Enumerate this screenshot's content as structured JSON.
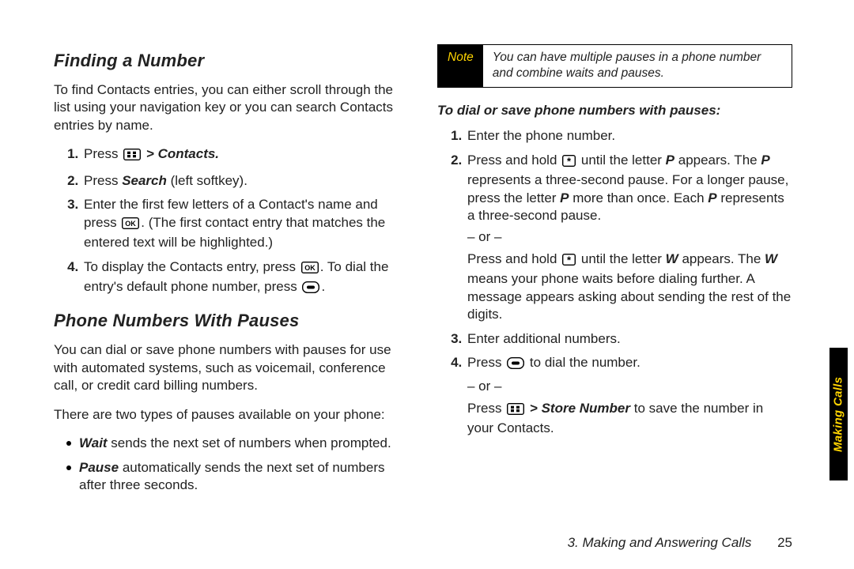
{
  "left": {
    "h_finding": "Finding a Number",
    "finding_intro": "To find Contacts entries, you can either scroll through the list using your navigation key or you can search Contacts entries by name.",
    "step1_prefix": "Press ",
    "step1_after_icon": "> Contacts.",
    "step2_a": "Press ",
    "step2_b": "Search",
    "step2_c": " (left softkey).",
    "step3": "Enter the first few letters of a Contact's name and press ",
    "step3_after": ". (The first contact entry that matches the entered text will be highlighted.)",
    "step4_a": "To display the Contacts entry, press ",
    "step4_b": ". To dial the entry's default phone number, press ",
    "step4_c": ".",
    "h_pauses": "Phone Numbers With Pauses",
    "pauses_intro": "You can dial or save phone numbers with pauses for use with automated systems, such as voicemail, conference call, or credit card billing numbers.",
    "pauses_types": "There are two types of pauses available on your phone:",
    "wait_a": "Wait",
    "wait_b": " sends the next set of numbers when prompted.",
    "pause_a": "Pause",
    "pause_b": " automatically sends the next set of numbers after three seconds."
  },
  "right": {
    "note_label": "Note",
    "note_text": "You can have multiple pauses in a phone number and combine waits and pauses.",
    "sub_h": "To dial or save phone numbers with pauses:",
    "r1": "Enter the phone number.",
    "r2_a": "Press and hold ",
    "r2_b": " until the letter ",
    "r2_c": "P",
    "r2_d": " appears. The ",
    "r2_e": "P",
    "r2_f": " represents a three-second pause. For a longer pause, press the letter ",
    "r2_g": "P",
    "r2_h": " more than once. Each ",
    "r2_i": "P",
    "r2_j": " represents a three-second pause.",
    "or": "– or –",
    "r2b_a": "Press and hold ",
    "r2b_b": " until the letter ",
    "r2b_c": "W",
    "r2b_d": " appears. The ",
    "r2b_e": "W",
    "r2b_f": " means your phone waits before dialing further. A message appears asking about sending the rest of the digits.",
    "r3": "Enter additional numbers.",
    "r4_a": "Press ",
    "r4_b": " to dial the number.",
    "r4_or": "– or –",
    "r4c_a": "Press ",
    "r4c_b": "> Store Number",
    "r4c_c": " to save the number in your Contacts."
  },
  "footer": {
    "section": "3. Making and Answering Calls",
    "page": "25"
  },
  "tab": "Making Calls"
}
